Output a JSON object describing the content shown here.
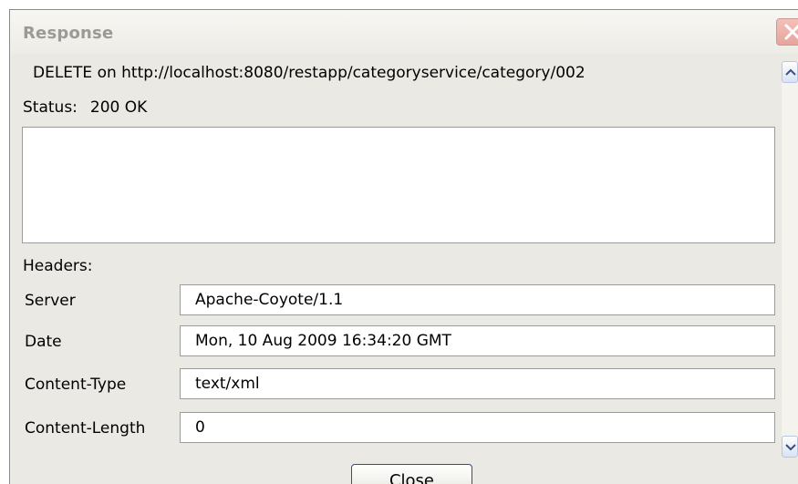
{
  "window": {
    "title": "Response",
    "close_icon": "close-x-icon"
  },
  "request": {
    "line": "DELETE on http://localhost:8080/restapp/categoryservice/category/002"
  },
  "status": {
    "label": "Status:",
    "value": "200 OK"
  },
  "response_body": {
    "value": ""
  },
  "headers": {
    "label": "Headers:",
    "rows": [
      {
        "name": "Server",
        "value": "Apache-Coyote/1.1"
      },
      {
        "name": "Date",
        "value": "Mon, 10 Aug 2009 16:34:20 GMT"
      },
      {
        "name": "Content-Type",
        "value": "text/xml"
      },
      {
        "name": "Content-Length",
        "value": "0"
      }
    ]
  },
  "buttons": {
    "close_label": "Close"
  },
  "scrollbar": {
    "up_icon": "chevron-up-icon",
    "down_icon": "chevron-down-icon"
  }
}
